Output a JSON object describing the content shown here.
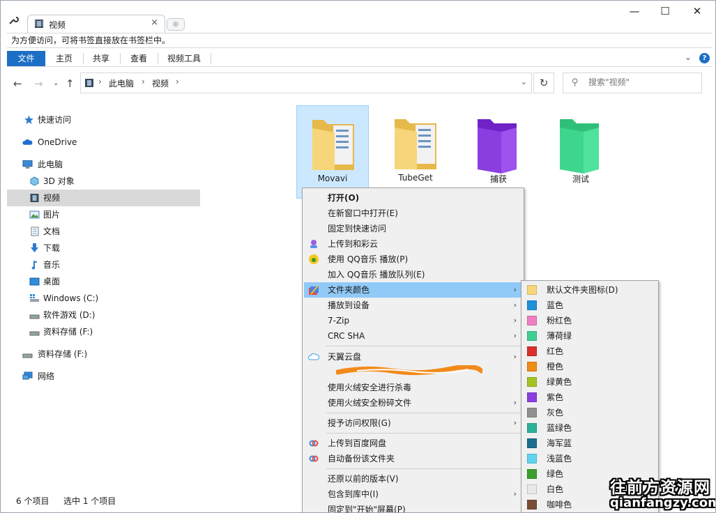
{
  "window": {
    "tab_title": "视频",
    "new_tab": "⊕",
    "minimize": "—",
    "maximize": "☐",
    "close": "✕"
  },
  "bookmark_hint": "为方便访问，可将书签直接放在书签栏中。",
  "ribbon": {
    "tabs": [
      "文件",
      "主页",
      "共享",
      "查看",
      "视频工具"
    ],
    "help": "?"
  },
  "address": {
    "crumbs": [
      "此电脑",
      "视频"
    ],
    "search_placeholder": "搜索\"视频\""
  },
  "sidebar": {
    "items": [
      {
        "label": "快速访问",
        "icon": "star-icon"
      },
      {
        "label": "OneDrive",
        "icon": "cloud-icon"
      },
      {
        "label": "此电脑",
        "icon": "computer-icon"
      },
      {
        "label": "3D 对象",
        "icon": "cube-icon"
      },
      {
        "label": "视频",
        "icon": "film-icon"
      },
      {
        "label": "图片",
        "icon": "picture-icon"
      },
      {
        "label": "文档",
        "icon": "document-icon"
      },
      {
        "label": "下载",
        "icon": "download-icon"
      },
      {
        "label": "音乐",
        "icon": "music-icon"
      },
      {
        "label": "桌面",
        "icon": "desktop-icon"
      },
      {
        "label": "Windows (C:)",
        "icon": "drive-icon"
      },
      {
        "label": "软件游戏 (D:)",
        "icon": "drive-icon"
      },
      {
        "label": "资料存储 (F:)",
        "icon": "drive-icon"
      },
      {
        "label": "资料存储 (F:)",
        "icon": "drive-icon"
      },
      {
        "label": "网络",
        "icon": "network-icon"
      }
    ]
  },
  "folders": [
    {
      "label": "Movavi",
      "color": "#f7d57a"
    },
    {
      "label": "TubeGet",
      "color": "#f7d57a"
    },
    {
      "label": "捕获",
      "color": "#8b3ee0"
    },
    {
      "label": "测试",
      "color": "#3ed68e"
    }
  ],
  "status": {
    "count": "6 个项目",
    "selected": "选中 1 个项目"
  },
  "context_menu": {
    "items": [
      {
        "label": "打开(O)",
        "bold": true
      },
      {
        "label": "在新窗口中打开(E)"
      },
      {
        "label": "固定到快速访问"
      },
      {
        "label": "上传到和彩云",
        "icon": "caiyun-icon"
      },
      {
        "label": "使用 QQ音乐 播放(P)",
        "icon": "qqmusic-icon"
      },
      {
        "label": "加入 QQ音乐 播放队列(E)"
      },
      {
        "label": "文件夹颜色",
        "icon": "paint-icon",
        "arrow": true,
        "highlight": true
      },
      {
        "label": "播放到设备",
        "arrow": true
      },
      {
        "label": "7-Zip",
        "arrow": true
      },
      {
        "label": "CRC SHA",
        "arrow": true
      },
      {
        "label": "天翼云盘",
        "icon": "tianyi-icon",
        "arrow": true
      },
      {
        "label": "使用火绒安全进行杀毒"
      },
      {
        "label": "使用火绒安全粉碎文件",
        "arrow": true
      },
      {
        "label": "授予访问权限(G)",
        "arrow": true
      },
      {
        "label": "上传到百度网盘",
        "icon": "baidu-icon"
      },
      {
        "label": "自动备份该文件夹",
        "icon": "baidu-icon"
      },
      {
        "label": "还原以前的版本(V)"
      },
      {
        "label": "包含到库中(I)",
        "arrow": true
      },
      {
        "label": "固定到\"开始\"屏幕(P)"
      }
    ]
  },
  "color_menu": {
    "items": [
      {
        "label": "默认文件夹图标(D)",
        "color": "#f7d57a"
      },
      {
        "label": "蓝色",
        "color": "#1e90d8"
      },
      {
        "label": "粉红色",
        "color": "#ef7fc4"
      },
      {
        "label": "薄荷绿",
        "color": "#3fcf92"
      },
      {
        "label": "红色",
        "color": "#d9302c"
      },
      {
        "label": "橙色",
        "color": "#f08c18"
      },
      {
        "label": "绿黄色",
        "color": "#a3c324"
      },
      {
        "label": "紫色",
        "color": "#8b3ee0"
      },
      {
        "label": "灰色",
        "color": "#909090"
      },
      {
        "label": "蓝绿色",
        "color": "#2bb29a"
      },
      {
        "label": "海军蓝",
        "color": "#1b6e8f"
      },
      {
        "label": "浅蓝色",
        "color": "#5fd3ee"
      },
      {
        "label": "绿色",
        "color": "#3a9f2e"
      },
      {
        "label": "白色",
        "color": "#e8e8e8"
      },
      {
        "label": "咖啡色",
        "color": "#7a4e36"
      }
    ]
  },
  "watermark": {
    "line1": "往前方资源网",
    "line2": "qianfangzy.com"
  }
}
